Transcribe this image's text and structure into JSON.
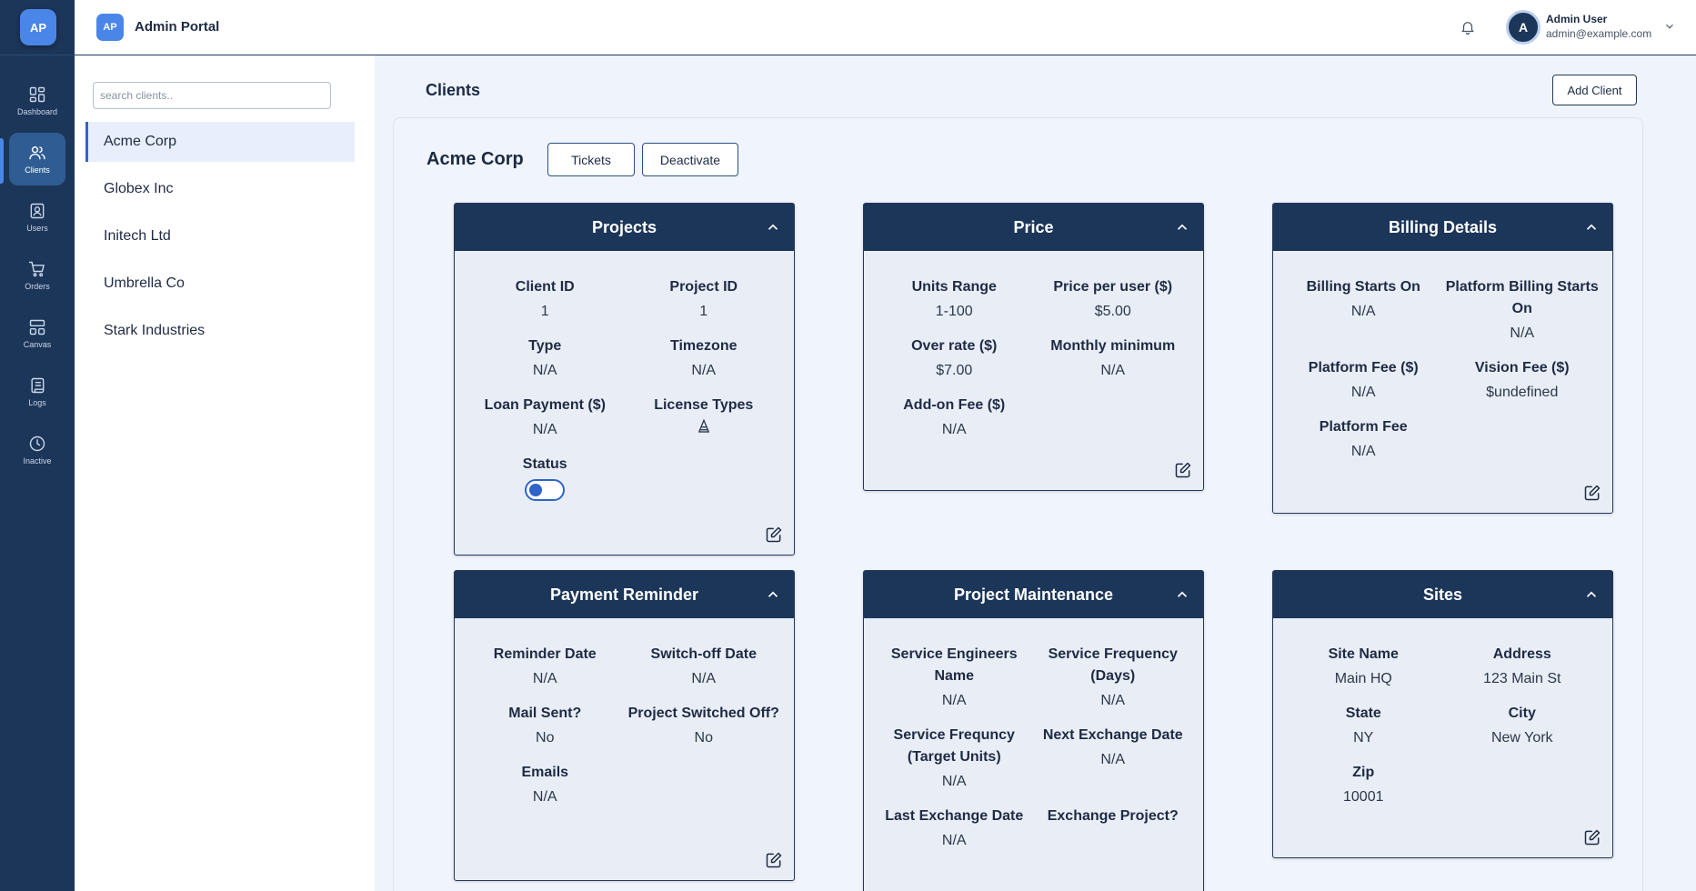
{
  "app": {
    "logo": "AP",
    "title": "Admin Portal"
  },
  "user": {
    "initial": "A",
    "name": "Admin User",
    "email": "admin@example.com"
  },
  "nav": [
    {
      "label": "Dashboard",
      "icon": "dashboard-icon"
    },
    {
      "label": "Clients",
      "icon": "users-icon",
      "active": true
    },
    {
      "label": "Users",
      "icon": "user-card-icon"
    },
    {
      "label": "Orders",
      "icon": "cart-icon"
    },
    {
      "label": "Canvas",
      "icon": "layout-icon"
    },
    {
      "label": "Logs",
      "icon": "scroll-icon"
    },
    {
      "label": "Inactive",
      "icon": "clock-icon"
    }
  ],
  "search": {
    "placeholder": "search clients.."
  },
  "clients": [
    "Acme Corp",
    "Globex Inc",
    "Initech Ltd",
    "Umbrella Co",
    "Stark Industries"
  ],
  "page": {
    "title": "Clients",
    "add_button": "Add Client"
  },
  "selected": {
    "name": "Acme Corp",
    "tickets_button": "Tickets",
    "deactivate_button": "Deactivate"
  },
  "sections": {
    "projects": {
      "title": "Projects",
      "client_id_label": "Client ID",
      "client_id": "1",
      "project_id_label": "Project ID",
      "project_id": "1",
      "type_label": "Type",
      "type": "N/A",
      "timezone_label": "Timezone",
      "timezone": "N/A",
      "loan_label": "Loan Payment ($)",
      "loan": "N/A",
      "license_label": "License Types",
      "status_label": "Status",
      "status_on": false
    },
    "price": {
      "title": "Price",
      "units_label": "Units Range",
      "units": "1-100",
      "ppu_label": "Price per user ($)",
      "ppu": "$5.00",
      "over_label": "Over rate ($)",
      "over": "$7.00",
      "min_label": "Monthly minimum",
      "min": "N/A",
      "addon_label": "Add-on Fee ($)",
      "addon": "N/A"
    },
    "billing": {
      "title": "Billing Details",
      "starts_label": "Billing Starts On",
      "starts": "N/A",
      "platform_starts_label": "Platform Billing Starts On",
      "platform_starts": "N/A",
      "platform_fee_d_label": "Platform Fee ($)",
      "platform_fee_d": "N/A",
      "vision_label": "Vision Fee ($)",
      "vision": "$undefined",
      "platform_fee_label": "Platform Fee",
      "platform_fee": "N/A"
    },
    "reminder": {
      "title": "Payment Reminder",
      "date_label": "Reminder Date",
      "date": "N/A",
      "switch_label": "Switch-off Date",
      "switch": "N/A",
      "mail_label": "Mail Sent?",
      "mail": "No",
      "switched_label": "Project Switched Off?",
      "switched": "No",
      "emails_label": "Emails",
      "emails": "N/A"
    },
    "maintenance": {
      "title": "Project Maintenance",
      "engineers_label": "Service Engineers Name",
      "engineers": "N/A",
      "freq_days_label": "Service Frequency (Days)",
      "freq_days": "N/A",
      "freq_units_label": "Service Frequncy (Target Units)",
      "freq_units": "N/A",
      "next_label": "Next Exchange Date",
      "next": "N/A",
      "last_label": "Last Exchange Date",
      "last": "N/A",
      "exchange_label": "Exchange Project?"
    },
    "sites": {
      "title": "Sites",
      "name_label": "Site Name",
      "name": "Main HQ",
      "address_label": "Address",
      "address": "123 Main St",
      "state_label": "State",
      "state": "NY",
      "city_label": "City",
      "city": "New York",
      "zip_label": "Zip",
      "zip": "10001"
    }
  }
}
